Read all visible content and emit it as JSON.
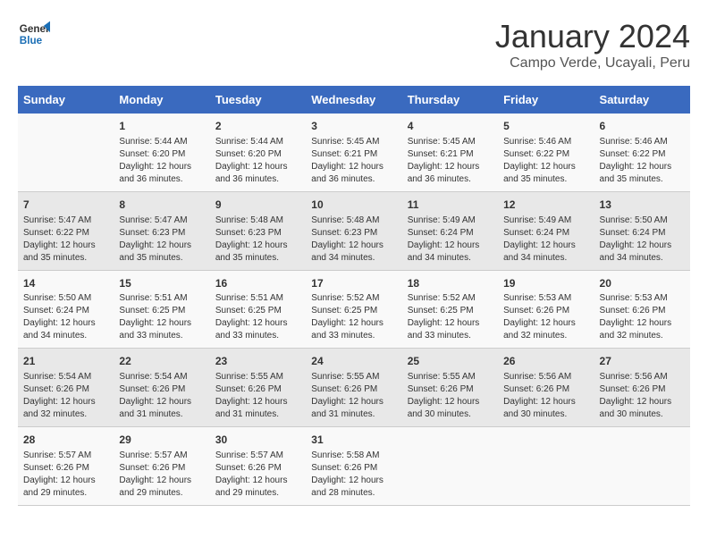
{
  "logo": {
    "line1": "General",
    "line2": "Blue"
  },
  "title": "January 2024",
  "subtitle": "Campo Verde, Ucayali, Peru",
  "headers": [
    "Sunday",
    "Monday",
    "Tuesday",
    "Wednesday",
    "Thursday",
    "Friday",
    "Saturday"
  ],
  "weeks": [
    [
      {
        "day": "",
        "info": ""
      },
      {
        "day": "1",
        "info": "Sunrise: 5:44 AM\nSunset: 6:20 PM\nDaylight: 12 hours\nand 36 minutes."
      },
      {
        "day": "2",
        "info": "Sunrise: 5:44 AM\nSunset: 6:20 PM\nDaylight: 12 hours\nand 36 minutes."
      },
      {
        "day": "3",
        "info": "Sunrise: 5:45 AM\nSunset: 6:21 PM\nDaylight: 12 hours\nand 36 minutes."
      },
      {
        "day": "4",
        "info": "Sunrise: 5:45 AM\nSunset: 6:21 PM\nDaylight: 12 hours\nand 36 minutes."
      },
      {
        "day": "5",
        "info": "Sunrise: 5:46 AM\nSunset: 6:22 PM\nDaylight: 12 hours\nand 35 minutes."
      },
      {
        "day": "6",
        "info": "Sunrise: 5:46 AM\nSunset: 6:22 PM\nDaylight: 12 hours\nand 35 minutes."
      }
    ],
    [
      {
        "day": "7",
        "info": "Sunrise: 5:47 AM\nSunset: 6:22 PM\nDaylight: 12 hours\nand 35 minutes."
      },
      {
        "day": "8",
        "info": "Sunrise: 5:47 AM\nSunset: 6:23 PM\nDaylight: 12 hours\nand 35 minutes."
      },
      {
        "day": "9",
        "info": "Sunrise: 5:48 AM\nSunset: 6:23 PM\nDaylight: 12 hours\nand 35 minutes."
      },
      {
        "day": "10",
        "info": "Sunrise: 5:48 AM\nSunset: 6:23 PM\nDaylight: 12 hours\nand 34 minutes."
      },
      {
        "day": "11",
        "info": "Sunrise: 5:49 AM\nSunset: 6:24 PM\nDaylight: 12 hours\nand 34 minutes."
      },
      {
        "day": "12",
        "info": "Sunrise: 5:49 AM\nSunset: 6:24 PM\nDaylight: 12 hours\nand 34 minutes."
      },
      {
        "day": "13",
        "info": "Sunrise: 5:50 AM\nSunset: 6:24 PM\nDaylight: 12 hours\nand 34 minutes."
      }
    ],
    [
      {
        "day": "14",
        "info": "Sunrise: 5:50 AM\nSunset: 6:24 PM\nDaylight: 12 hours\nand 34 minutes."
      },
      {
        "day": "15",
        "info": "Sunrise: 5:51 AM\nSunset: 6:25 PM\nDaylight: 12 hours\nand 33 minutes."
      },
      {
        "day": "16",
        "info": "Sunrise: 5:51 AM\nSunset: 6:25 PM\nDaylight: 12 hours\nand 33 minutes."
      },
      {
        "day": "17",
        "info": "Sunrise: 5:52 AM\nSunset: 6:25 PM\nDaylight: 12 hours\nand 33 minutes."
      },
      {
        "day": "18",
        "info": "Sunrise: 5:52 AM\nSunset: 6:25 PM\nDaylight: 12 hours\nand 33 minutes."
      },
      {
        "day": "19",
        "info": "Sunrise: 5:53 AM\nSunset: 6:26 PM\nDaylight: 12 hours\nand 32 minutes."
      },
      {
        "day": "20",
        "info": "Sunrise: 5:53 AM\nSunset: 6:26 PM\nDaylight: 12 hours\nand 32 minutes."
      }
    ],
    [
      {
        "day": "21",
        "info": "Sunrise: 5:54 AM\nSunset: 6:26 PM\nDaylight: 12 hours\nand 32 minutes."
      },
      {
        "day": "22",
        "info": "Sunrise: 5:54 AM\nSunset: 6:26 PM\nDaylight: 12 hours\nand 31 minutes."
      },
      {
        "day": "23",
        "info": "Sunrise: 5:55 AM\nSunset: 6:26 PM\nDaylight: 12 hours\nand 31 minutes."
      },
      {
        "day": "24",
        "info": "Sunrise: 5:55 AM\nSunset: 6:26 PM\nDaylight: 12 hours\nand 31 minutes."
      },
      {
        "day": "25",
        "info": "Sunrise: 5:55 AM\nSunset: 6:26 PM\nDaylight: 12 hours\nand 30 minutes."
      },
      {
        "day": "26",
        "info": "Sunrise: 5:56 AM\nSunset: 6:26 PM\nDaylight: 12 hours\nand 30 minutes."
      },
      {
        "day": "27",
        "info": "Sunrise: 5:56 AM\nSunset: 6:26 PM\nDaylight: 12 hours\nand 30 minutes."
      }
    ],
    [
      {
        "day": "28",
        "info": "Sunrise: 5:57 AM\nSunset: 6:26 PM\nDaylight: 12 hours\nand 29 minutes."
      },
      {
        "day": "29",
        "info": "Sunrise: 5:57 AM\nSunset: 6:26 PM\nDaylight: 12 hours\nand 29 minutes."
      },
      {
        "day": "30",
        "info": "Sunrise: 5:57 AM\nSunset: 6:26 PM\nDaylight: 12 hours\nand 29 minutes."
      },
      {
        "day": "31",
        "info": "Sunrise: 5:58 AM\nSunset: 6:26 PM\nDaylight: 12 hours\nand 28 minutes."
      },
      {
        "day": "",
        "info": ""
      },
      {
        "day": "",
        "info": ""
      },
      {
        "day": "",
        "info": ""
      }
    ]
  ]
}
